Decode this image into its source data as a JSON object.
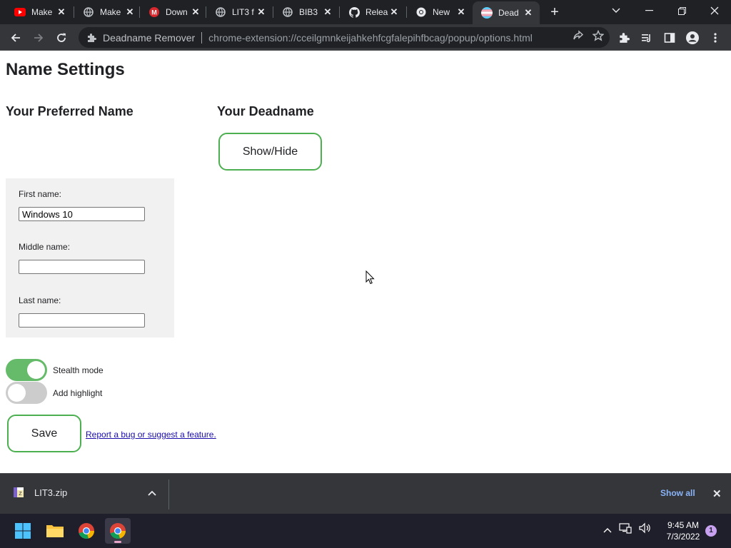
{
  "browser": {
    "tabs": [
      {
        "title": "Make",
        "icon": "youtube-icon",
        "active": false
      },
      {
        "title": "Make",
        "icon": "globe-icon",
        "active": false
      },
      {
        "title": "Down",
        "icon": "mega-icon",
        "active": false
      },
      {
        "title": "LIT3 f",
        "icon": "globe-icon",
        "active": false
      },
      {
        "title": "BIB3",
        "icon": "globe-icon",
        "active": false
      },
      {
        "title": "Relea",
        "icon": "github-icon",
        "active": false
      },
      {
        "title": "New",
        "icon": "chrome-icon",
        "active": false
      },
      {
        "title": "Dead",
        "icon": "trans-flag-icon",
        "active": true
      }
    ],
    "omnibox": {
      "extension_name": "Deadname Remover",
      "url": "chrome-extension://cceilgmnkeijahkehfcgfalepihfbcag/popup/options.html"
    }
  },
  "page": {
    "title": "Name Settings",
    "preferred_heading": "Your Preferred Name",
    "deadname_heading": "Your Deadname",
    "show_hide_label": "Show/Hide",
    "fields": {
      "first_label": "First name:",
      "first_value": "Windows 10",
      "middle_label": "Middle name:",
      "middle_value": "",
      "last_label": "Last name:",
      "last_value": ""
    },
    "toggles": {
      "stealth_label": "Stealth mode",
      "stealth_on": true,
      "highlight_label": "Add highlight",
      "highlight_on": false
    },
    "save_label": "Save",
    "report_link": "Report a bug or suggest a feature."
  },
  "downloads": {
    "file_name": "LIT3.zip",
    "show_all_label": "Show all"
  },
  "taskbar": {
    "time": "9:45 AM",
    "date": "7/3/2022",
    "notification_count": "1"
  },
  "colors": {
    "accent_green": "#4caf50",
    "toggle_on": "#66bb6a",
    "link": "#1a0dab"
  }
}
